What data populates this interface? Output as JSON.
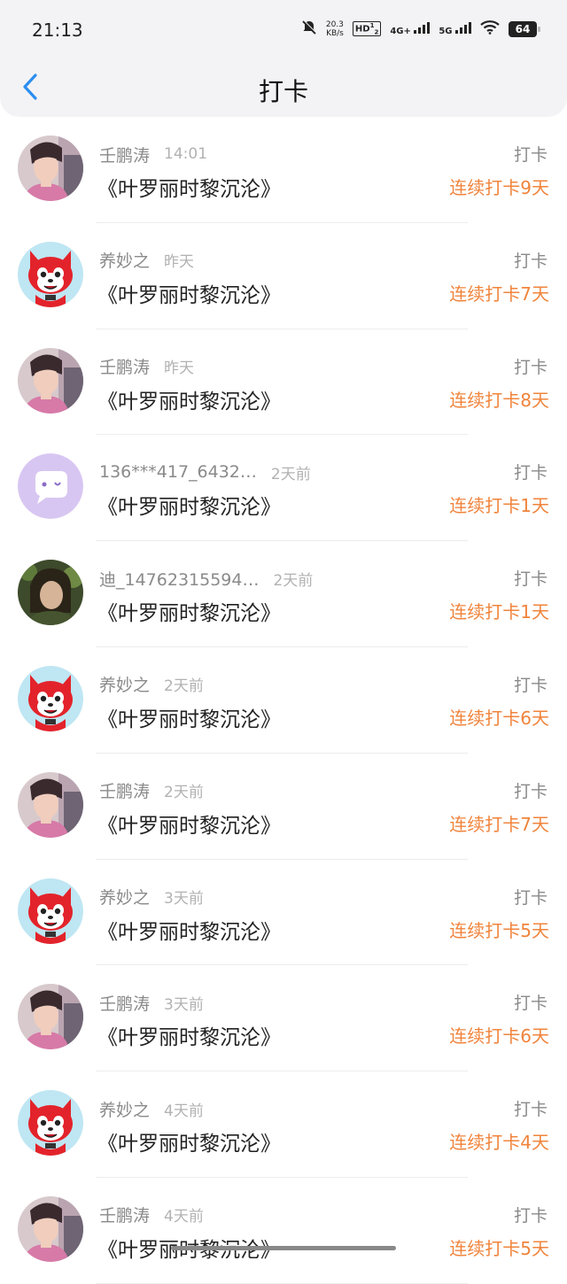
{
  "status_bar": {
    "time": "21:13",
    "speed_value": "20.3",
    "speed_unit": "KB/s",
    "hd": "HD",
    "sim1": "1",
    "sim2": "2",
    "network_1": "4G+",
    "network_2": "5G",
    "battery": "64"
  },
  "header": {
    "title": "打卡"
  },
  "entries": [
    {
      "name": "壬鹏涛",
      "time": "14:01",
      "book": "《叶罗丽时黎沉沦》",
      "action": "打卡",
      "streak": "连续打卡9天",
      "avatar": "man"
    },
    {
      "name": "养妙之",
      "time": "昨天",
      "book": "《叶罗丽时黎沉沦》",
      "action": "打卡",
      "streak": "连续打卡7天",
      "avatar": "fox"
    },
    {
      "name": "壬鹏涛",
      "time": "昨天",
      "book": "《叶罗丽时黎沉沦》",
      "action": "打卡",
      "streak": "连续打卡8天",
      "avatar": "man"
    },
    {
      "name": "136***417_6432…",
      "time": "2天前",
      "book": "《叶罗丽时黎沉沦》",
      "action": "打卡",
      "streak": "连续打卡1天",
      "avatar": "chat"
    },
    {
      "name": "迪_14762315594…",
      "time": "2天前",
      "book": "《叶罗丽时黎沉沦》",
      "action": "打卡",
      "streak": "连续打卡1天",
      "avatar": "girl"
    },
    {
      "name": "养妙之",
      "time": "2天前",
      "book": "《叶罗丽时黎沉沦》",
      "action": "打卡",
      "streak": "连续打卡6天",
      "avatar": "fox"
    },
    {
      "name": "壬鹏涛",
      "time": "2天前",
      "book": "《叶罗丽时黎沉沦》",
      "action": "打卡",
      "streak": "连续打卡7天",
      "avatar": "man"
    },
    {
      "name": "养妙之",
      "time": "3天前",
      "book": "《叶罗丽时黎沉沦》",
      "action": "打卡",
      "streak": "连续打卡5天",
      "avatar": "fox"
    },
    {
      "name": "壬鹏涛",
      "time": "3天前",
      "book": "《叶罗丽时黎沉沦》",
      "action": "打卡",
      "streak": "连续打卡6天",
      "avatar": "man"
    },
    {
      "name": "养妙之",
      "time": "4天前",
      "book": "《叶罗丽时黎沉沦》",
      "action": "打卡",
      "streak": "连续打卡4天",
      "avatar": "fox"
    },
    {
      "name": "壬鹏涛",
      "time": "4天前",
      "book": "《叶罗丽时黎沉沦》",
      "action": "打卡",
      "streak": "连续打卡5天",
      "avatar": "man"
    }
  ],
  "colors": {
    "accent": "#f0843c",
    "back_arrow": "#2b8ef0",
    "header_bg": "#f3f3f5"
  }
}
